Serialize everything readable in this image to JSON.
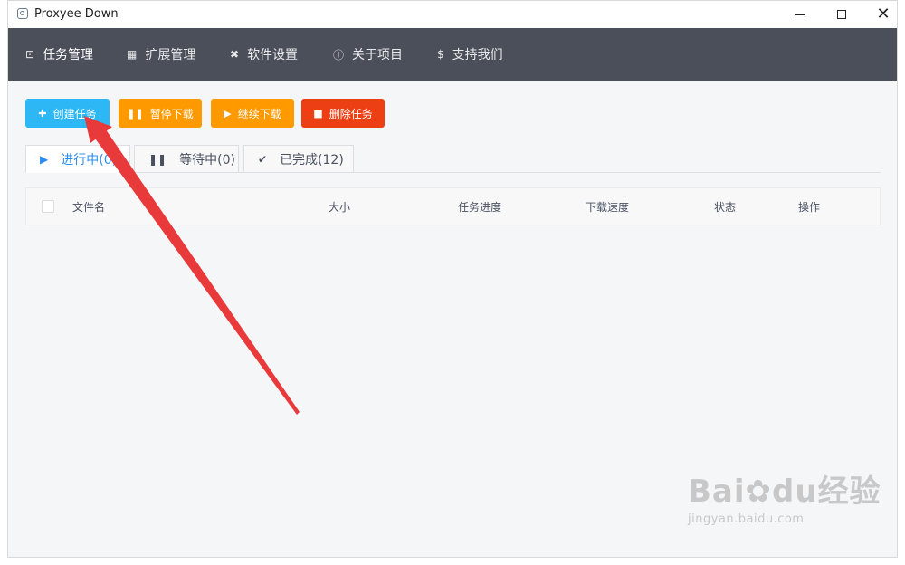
{
  "window": {
    "title": "Proxyee Down"
  },
  "navbar": {
    "items": [
      {
        "icon": "task-icon",
        "label": "任务管理"
      },
      {
        "icon": "extension-icon",
        "label": "扩展管理"
      },
      {
        "icon": "tools-icon",
        "label": "软件设置"
      },
      {
        "icon": "info-icon",
        "label": "关于项目"
      },
      {
        "icon": "dollar-icon",
        "label": "支持我们"
      }
    ]
  },
  "toolbar": {
    "create_label": "创建任务",
    "pause_label": "暂停下载",
    "resume_label": "继续下载",
    "delete_label": "删除任务"
  },
  "tabs": [
    {
      "icon": "play-icon",
      "label": "进行中(0)"
    },
    {
      "icon": "pause-icon",
      "label": "等待中(0)"
    },
    {
      "icon": "check-icon",
      "label": "已完成(12)"
    }
  ],
  "table": {
    "columns": [
      "文件名",
      "大小",
      "任务进度",
      "下载速度",
      "状态",
      "操作"
    ]
  },
  "watermark": {
    "brand": "Bai",
    "brand2": "du",
    "suffix": "经验",
    "url": "jingyan.baidu.com"
  },
  "colors": {
    "nav_bg": "#4b4f5a",
    "primary": "#2db7f5",
    "warning": "#ff9900",
    "danger": "#ed3f14",
    "annotation": "#e83a3a"
  }
}
